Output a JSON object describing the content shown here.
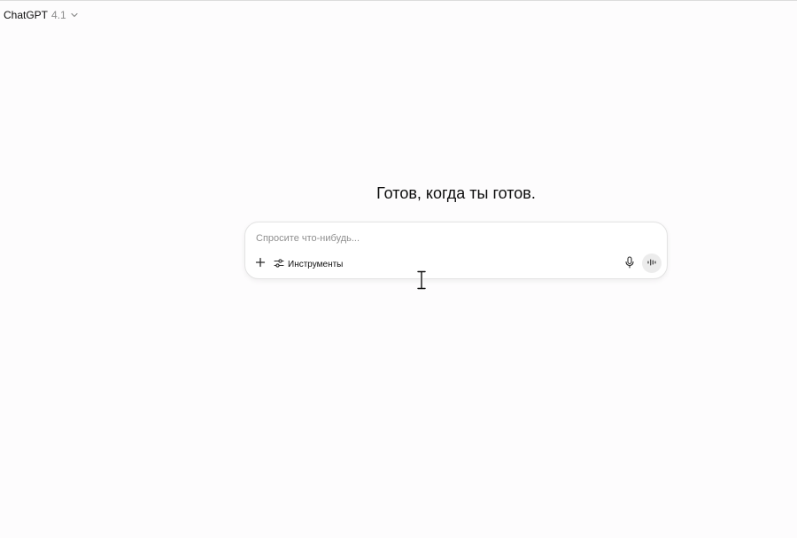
{
  "header": {
    "model_name": "ChatGPT",
    "model_version": "4.1",
    "chevron_icon": "chevron-down-icon"
  },
  "main": {
    "headline": "Готов, когда ты готов."
  },
  "composer": {
    "placeholder": "Спросите что-нибудь...",
    "value": "",
    "plus_icon": "plus-icon",
    "tools_icon": "sliders-icon",
    "tools_label": "Инструменты",
    "mic_icon": "microphone-icon",
    "voice_icon": "voice-mode-icon"
  },
  "colors": {
    "background": "#fdfcfd",
    "text": "#0d0d0d",
    "muted": "#8a8a8a",
    "composer_border": "#e3e3e3",
    "voice_button": "#ececec"
  }
}
